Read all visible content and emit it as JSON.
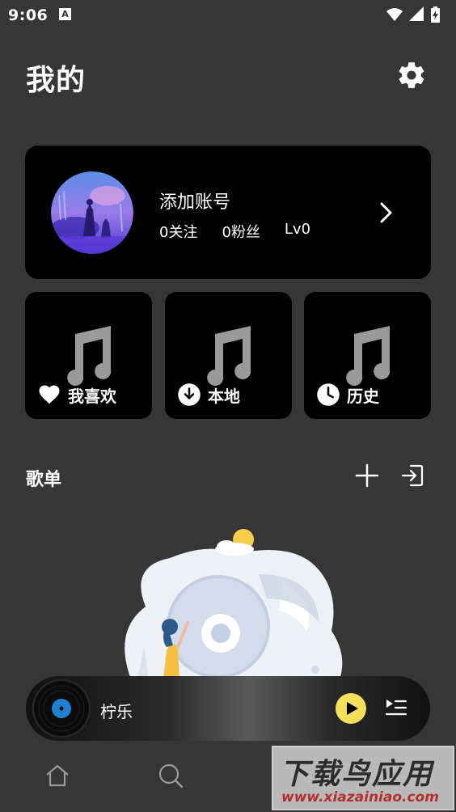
{
  "status_bar": {
    "time": "9:06",
    "notification_badge": "A",
    "icons": [
      "wifi-icon",
      "cell-signal-icon",
      "battery-charging-icon"
    ]
  },
  "header": {
    "title": "我的",
    "settings_icon": "gear-icon"
  },
  "profile": {
    "name": "添加账号",
    "following": "0关注",
    "followers": "0粉丝",
    "level": "Lv0"
  },
  "tiles": [
    {
      "label": "我喜欢",
      "icon": "heart-icon"
    },
    {
      "label": "本地",
      "icon": "download-icon"
    },
    {
      "label": "历史",
      "icon": "clock-icon"
    }
  ],
  "playlist_section": {
    "title": "歌单",
    "add_icon": "plus-icon",
    "import_icon": "import-icon"
  },
  "mini_player": {
    "track": "柠乐",
    "play_icon": "play-icon",
    "queue_icon": "playlist-queue-icon"
  },
  "bottom_nav": {
    "items": [
      "home-icon",
      "search-icon"
    ]
  },
  "watermark": {
    "line1": "下载鸟应用",
    "line2": "www.xiazainiao.com"
  },
  "colors": {
    "background": "#363636",
    "card": "#000000",
    "accent_yellow": "#f6e05a"
  }
}
